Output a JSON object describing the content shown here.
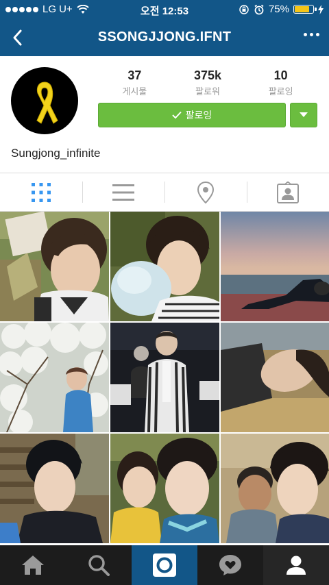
{
  "status_bar": {
    "carrier": "LG U+",
    "time": "오전 12:53",
    "battery": "75%",
    "battery_level": 0.75
  },
  "nav": {
    "title": "SSONGJJONG.IFNT"
  },
  "profile": {
    "username": "Sungjong_infinite",
    "stats": [
      {
        "value": "37",
        "label": "게시물"
      },
      {
        "value": "375k",
        "label": "팔로워"
      },
      {
        "value": "10",
        "label": "팔로잉"
      }
    ],
    "follow_label": "팔로잉"
  },
  "tabs": [
    {
      "icon": "grid-icon",
      "active": true
    },
    {
      "icon": "list-icon",
      "active": false
    },
    {
      "icon": "location-pin-icon",
      "active": false
    },
    {
      "icon": "tagged-photos-icon",
      "active": false
    }
  ],
  "photos": [
    {
      "desc": "selfie-with-sign"
    },
    {
      "desc": "cotton-candy"
    },
    {
      "desc": "sunset-beach"
    },
    {
      "desc": "cherry-blossom"
    },
    {
      "desc": "fashion-show"
    },
    {
      "desc": "lying-on-hay"
    },
    {
      "desc": "selfie-stairs"
    },
    {
      "desc": "selfie-with-girl"
    },
    {
      "desc": "selfie-with-man"
    }
  ],
  "bottom_nav": [
    {
      "icon": "home-icon"
    },
    {
      "icon": "search-icon"
    },
    {
      "icon": "camera-icon"
    },
    {
      "icon": "activity-heart-icon"
    },
    {
      "icon": "profile-icon"
    }
  ],
  "colors": {
    "brand": "#125688",
    "follow_green": "#6bbd3f",
    "tab_active": "#3897f0",
    "battery_yellow": "#f5c518"
  }
}
